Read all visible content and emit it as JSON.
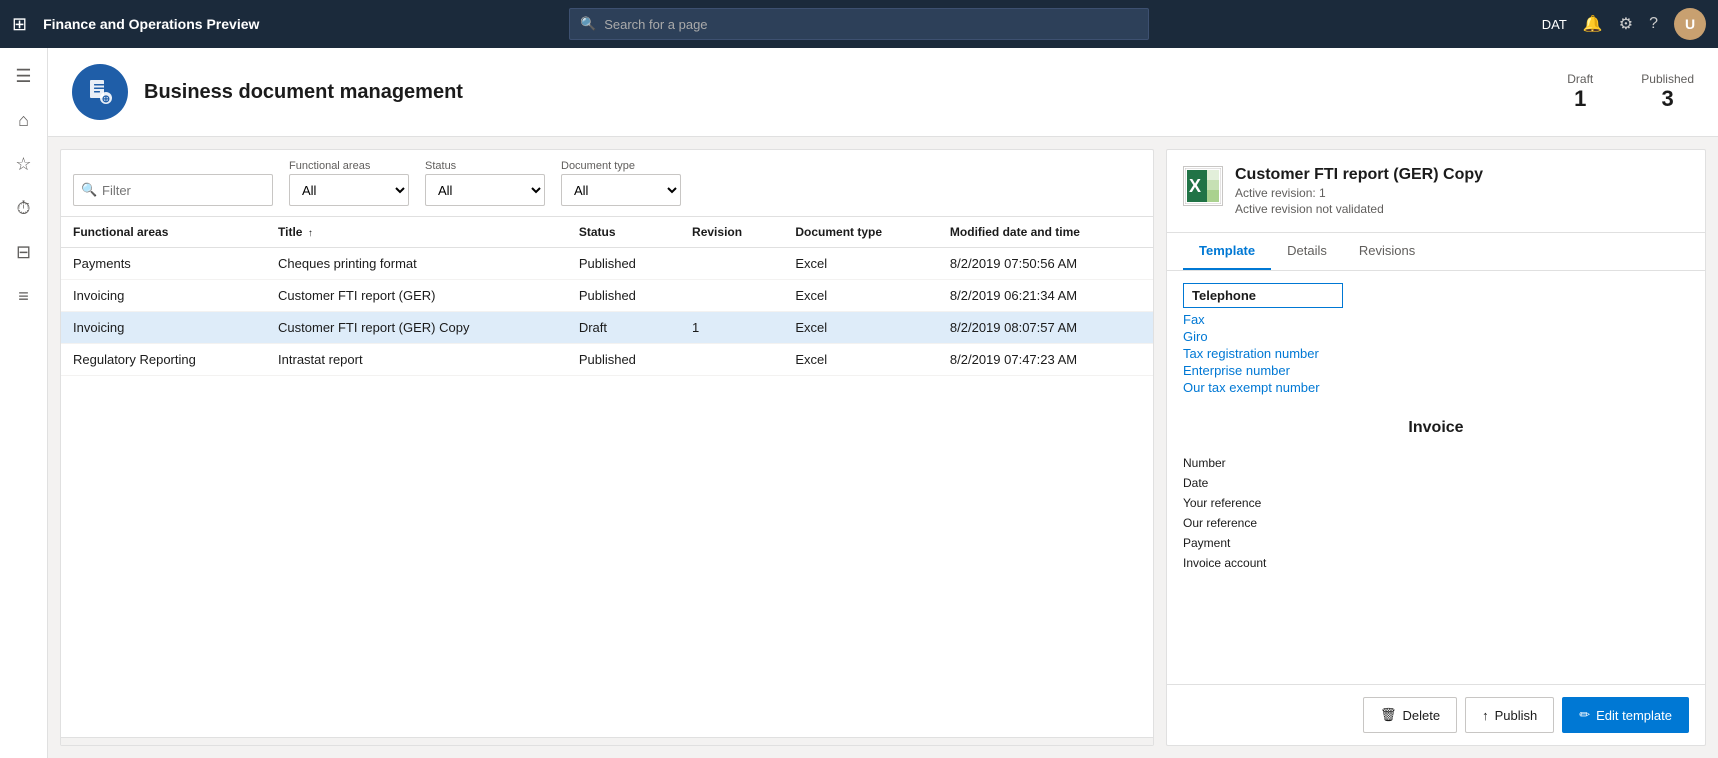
{
  "app": {
    "title": "Finance and Operations Preview",
    "environment": "DAT",
    "search_placeholder": "Search for a page"
  },
  "page": {
    "title": "Business document management",
    "icon_letter": "📄",
    "stats": {
      "draft_label": "Draft",
      "draft_value": "1",
      "published_label": "Published",
      "published_value": "3"
    }
  },
  "filters": {
    "filter_placeholder": "Filter",
    "functional_areas": {
      "label": "Functional areas",
      "options": [
        "All"
      ],
      "selected": "All"
    },
    "status": {
      "label": "Status",
      "options": [
        "All"
      ],
      "selected": "All"
    },
    "document_type": {
      "label": "Document type",
      "options": [
        "All"
      ],
      "selected": "All"
    }
  },
  "table": {
    "columns": [
      {
        "key": "functional_areas",
        "label": "Functional areas",
        "sortable": false
      },
      {
        "key": "title",
        "label": "Title",
        "sortable": true
      },
      {
        "key": "status",
        "label": "Status",
        "sortable": false
      },
      {
        "key": "revision",
        "label": "Revision",
        "sortable": false
      },
      {
        "key": "document_type",
        "label": "Document type",
        "sortable": false
      },
      {
        "key": "modified",
        "label": "Modified date and time",
        "sortable": false
      }
    ],
    "rows": [
      {
        "functional_areas": "Payments",
        "title": "Cheques printing format",
        "status": "Published",
        "revision": "",
        "document_type": "Excel",
        "modified": "8/2/2019 07:50:56 AM"
      },
      {
        "functional_areas": "Invoicing",
        "title": "Customer FTI report (GER)",
        "status": "Published",
        "revision": "",
        "document_type": "Excel",
        "modified": "8/2/2019 06:21:34 AM"
      },
      {
        "functional_areas": "Invoicing",
        "title": "Customer FTI report (GER) Copy",
        "status": "Draft",
        "revision": "1",
        "document_type": "Excel",
        "modified": "8/2/2019 08:07:57 AM",
        "selected": true
      },
      {
        "functional_areas": "Regulatory Reporting",
        "title": "Intrastat report",
        "status": "Published",
        "revision": "",
        "document_type": "Excel",
        "modified": "8/2/2019 07:47:23 AM"
      }
    ]
  },
  "detail": {
    "title": "Customer FTI report (GER) Copy",
    "sub1": "Active revision: 1",
    "sub2": "Active revision not validated",
    "tabs": [
      {
        "key": "template",
        "label": "Template",
        "active": true
      },
      {
        "key": "details",
        "label": "Details",
        "active": false
      },
      {
        "key": "revisions",
        "label": "Revisions",
        "active": false
      }
    ],
    "template": {
      "telephone_label": "Telephone",
      "links": [
        {
          "label": "Fax"
        },
        {
          "label": "Giro"
        },
        {
          "label": "Tax registration number"
        },
        {
          "label": "Enterprise number"
        },
        {
          "label": "Our tax exempt number"
        }
      ],
      "invoice_title": "Invoice",
      "invoice_fields": [
        "Number",
        "Date",
        "Your reference",
        "Our reference",
        "Payment",
        "Invoice account"
      ]
    },
    "buttons": {
      "delete": "Delete",
      "publish": "Publish",
      "edit_template": "Edit template"
    }
  },
  "sidebar": {
    "icons": [
      {
        "name": "hamburger-icon",
        "symbol": "☰"
      },
      {
        "name": "home-icon",
        "symbol": "🏠"
      },
      {
        "name": "star-icon",
        "symbol": "☆"
      },
      {
        "name": "clock-icon",
        "symbol": "🕐"
      },
      {
        "name": "grid-icon",
        "symbol": "⊞"
      },
      {
        "name": "list-icon",
        "symbol": "≡"
      }
    ]
  }
}
